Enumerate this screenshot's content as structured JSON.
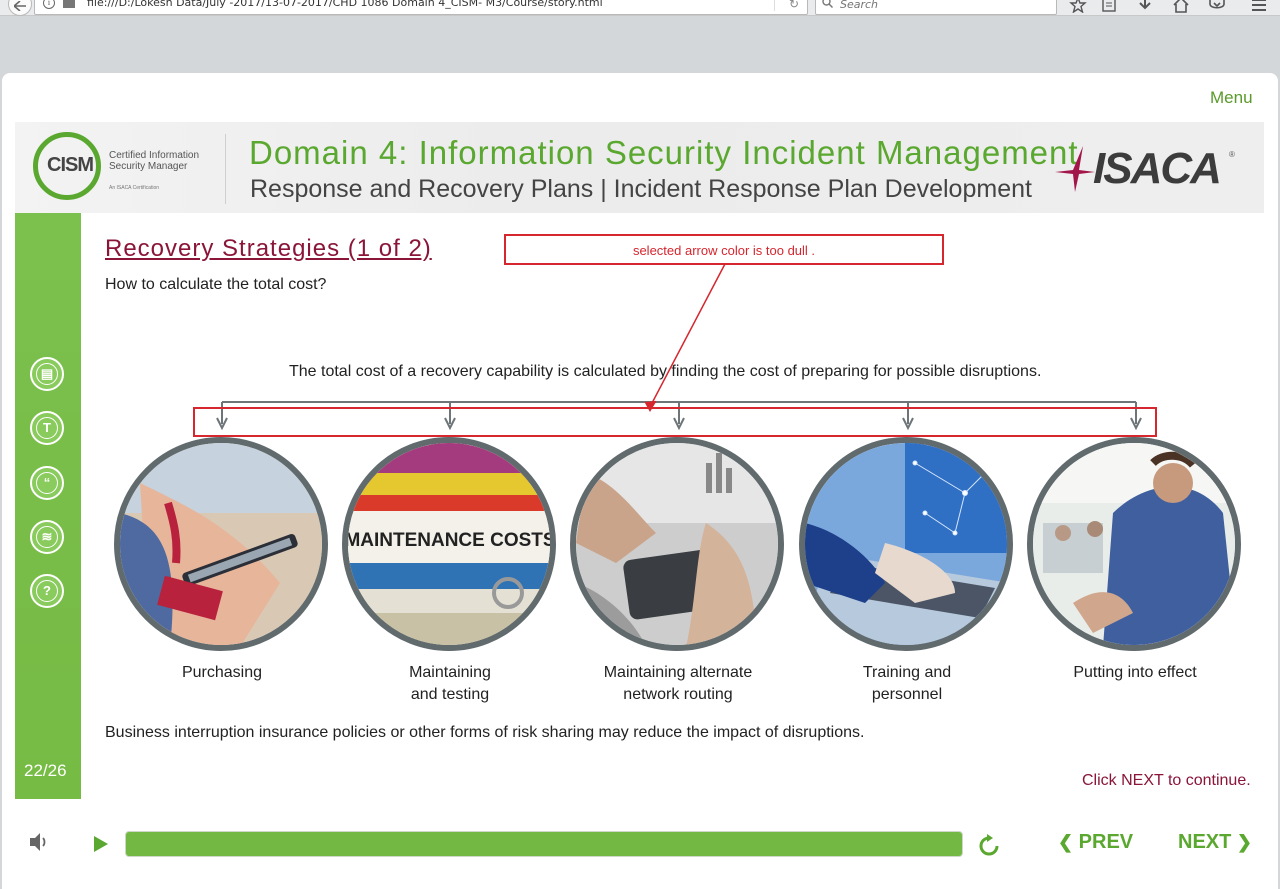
{
  "browser": {
    "url": "file:///D:/Lokesh Data/July -2017/13-07-2017/CHD 1086 Domain 4_CISM- M3/Course/story.html",
    "search_placeholder": "Search"
  },
  "menu_label": "Menu",
  "header": {
    "logo_acronym": "CISM",
    "logo_text": "Certified Information\nSecurity Manager",
    "logo_subtext": "An ISACA Certification",
    "domain_title": "Domain 4: Information Security Incident Management",
    "subtitle": "Response and Recovery Plans | Incident Response Plan Development",
    "isaca_logo": "ISACA",
    "isaca_reg": "®"
  },
  "sidebar": {
    "icons": [
      {
        "name": "notes-icon",
        "glyph": "▤"
      },
      {
        "name": "transcript-icon",
        "glyph": "T"
      },
      {
        "name": "quote-icon",
        "glyph": "“"
      },
      {
        "name": "layers-icon",
        "glyph": "≋"
      },
      {
        "name": "help-icon",
        "glyph": "?"
      }
    ],
    "page_counter": "22/26"
  },
  "slide": {
    "title": "Recovery Strategies (1 of 2)",
    "question": "How to calculate the total cost?",
    "statement": "The total cost of a recovery capability is calculated by finding the cost of preparing for possible disruptions.",
    "items": [
      {
        "label": "Purchasing",
        "image": "hands-phone-payment"
      },
      {
        "label": "Maintaining\nand testing",
        "image": "maintenance-costs-binders"
      },
      {
        "label": "Maintaining alternate\nnetwork routing",
        "image": "meeting-tablet"
      },
      {
        "label": "Training and\npersonnel",
        "image": "laptop-network"
      },
      {
        "label": "Putting into effect",
        "image": "presenter-office"
      }
    ],
    "footnote": "Business interruption insurance policies or other forms of risk sharing may reduce the impact of disruptions.",
    "next_prompt": "Click NEXT to continue."
  },
  "annotation": {
    "text": "selected arrow color is too dull ."
  },
  "player": {
    "progress_fraction": 1.0,
    "prev_label": "PREV",
    "next_label": "NEXT"
  },
  "colors": {
    "brand_green": "#5aa82f",
    "title_maroon": "#8a1538",
    "annotation_red": "#d6262e",
    "circle_border": "#616b6e"
  }
}
